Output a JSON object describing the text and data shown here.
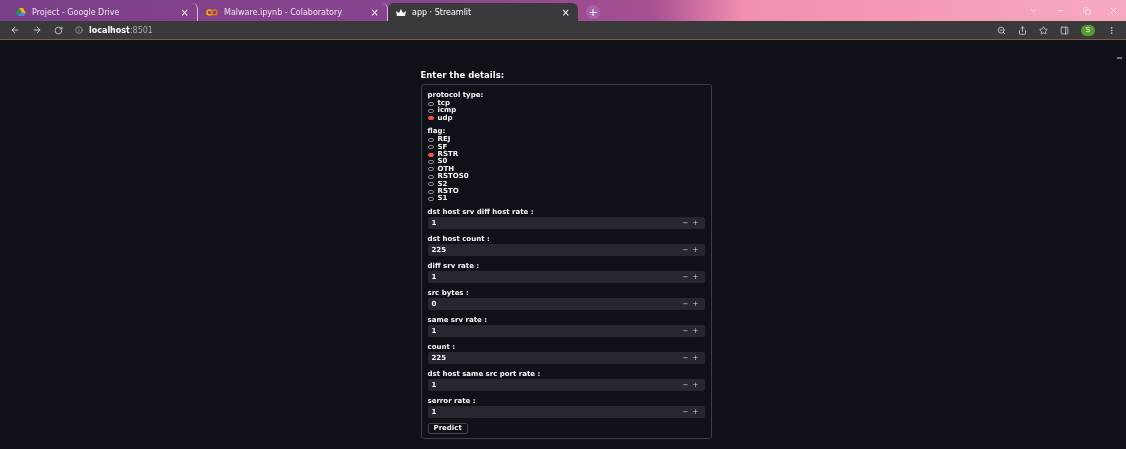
{
  "browser": {
    "tabs": [
      {
        "title": "Project - Google Drive",
        "selected": false,
        "close": "×"
      },
      {
        "title": "Malware.ipynb - Colaboratory",
        "selected": false,
        "close": "×"
      },
      {
        "title": "app · Streamlit",
        "selected": true,
        "close": "×"
      }
    ],
    "new_tab": "+",
    "address": "**localhost**:8501",
    "avatar": "S"
  },
  "page": {
    "title": "Enter the details:",
    "radio_groups": [
      {
        "label": "protocol type:",
        "options": [
          {
            "label": "tcp",
            "selected": false
          },
          {
            "label": "icmp",
            "selected": false
          },
          {
            "label": "udp",
            "selected": true
          }
        ]
      },
      {
        "label": "flag:",
        "options": [
          {
            "label": "REJ",
            "selected": false
          },
          {
            "label": "SF",
            "selected": false
          },
          {
            "label": "RSTR",
            "selected": true
          },
          {
            "label": "S0",
            "selected": false
          },
          {
            "label": "OTH",
            "selected": false
          },
          {
            "label": "RSTOS0",
            "selected": false
          },
          {
            "label": "S2",
            "selected": false
          },
          {
            "label": "RSTO",
            "selected": false
          },
          {
            "label": "S1",
            "selected": false
          }
        ]
      }
    ],
    "number_inputs": [
      {
        "label": "dst host srv diff host rate :",
        "value": "1",
        "minus": "−",
        "plus": "+"
      },
      {
        "label": "dst host count :",
        "value": "225",
        "minus": "−",
        "plus": "+"
      },
      {
        "label": "diff srv rate :",
        "value": "1",
        "minus": "−",
        "plus": "+"
      },
      {
        "label": "src bytes :",
        "value": "0",
        "minus": "−",
        "plus": "+"
      },
      {
        "label": "same srv rate :",
        "value": "1",
        "minus": "−",
        "plus": "+"
      },
      {
        "label": "count :",
        "value": "225",
        "minus": "−",
        "plus": "+"
      },
      {
        "label": "dst host same src port rate :",
        "value": "1",
        "minus": "−",
        "plus": "+"
      },
      {
        "label": "serror rate :",
        "value": "1",
        "minus": "−",
        "plus": "+"
      }
    ],
    "button": "Predict"
  }
}
